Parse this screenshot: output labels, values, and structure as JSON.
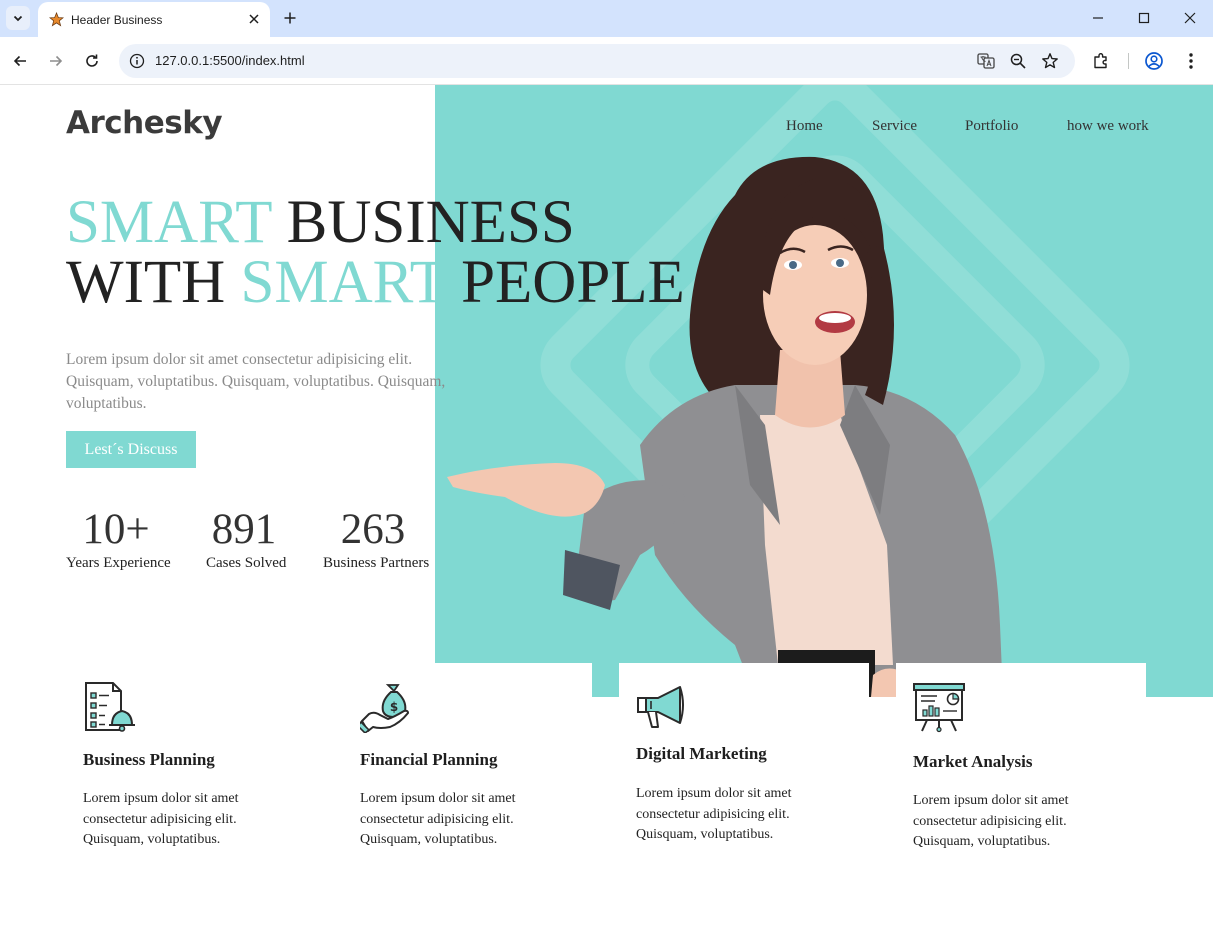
{
  "browser": {
    "tab_title": "Header Business",
    "url": "127.0.0.1:5500/index.html"
  },
  "site": {
    "logo": "Archesky",
    "nav": [
      "Home",
      "Service",
      "Portfolio",
      "how we work"
    ],
    "headline": {
      "line1_accent": "SMART",
      "line1_rest": " BUSINESS",
      "line2_start": "WITH ",
      "line2_accent": "SMART",
      "line2_end": " PEOPLE"
    },
    "lead": "Lorem ipsum dolor sit amet consectetur adipisicing elit. Quisquam, voluptatibus. Quisquam, voluptatibus. Quisquam, voluptatibus.",
    "cta_label": "Lest´s Discuss",
    "stats": [
      {
        "value": "10+",
        "label": "Years Experience"
      },
      {
        "value": "891",
        "label": "Cases Solved"
      },
      {
        "value": "263",
        "label": "Business Partners"
      }
    ],
    "services": [
      {
        "title": "Business Planning",
        "text": "Lorem ipsum dolor sit amet consectetur adipisicing elit. Quisquam, voluptatibus.",
        "icon": "business-planning-icon"
      },
      {
        "title": "Financial Planning",
        "text": "Lorem ipsum dolor sit amet consectetur adipisicing elit. Quisquam, voluptatibus.",
        "icon": "money-bag-hand-icon"
      },
      {
        "title": "Digital Marketing",
        "text": "Lorem ipsum dolor sit amet consectetur adipisicing elit. Quisquam, voluptatibus.",
        "icon": "megaphone-icon"
      },
      {
        "title": "Market Analysis",
        "text": "Lorem ipsum dolor sit amet consectetur adipisicing elit. Quisquam, voluptatibus.",
        "icon": "presentation-board-icon"
      }
    ]
  },
  "colors": {
    "accent": "#80d9d2",
    "text_dark": "#222222",
    "text_muted": "#8a8a8a",
    "tabbar": "#d3e3fd"
  }
}
